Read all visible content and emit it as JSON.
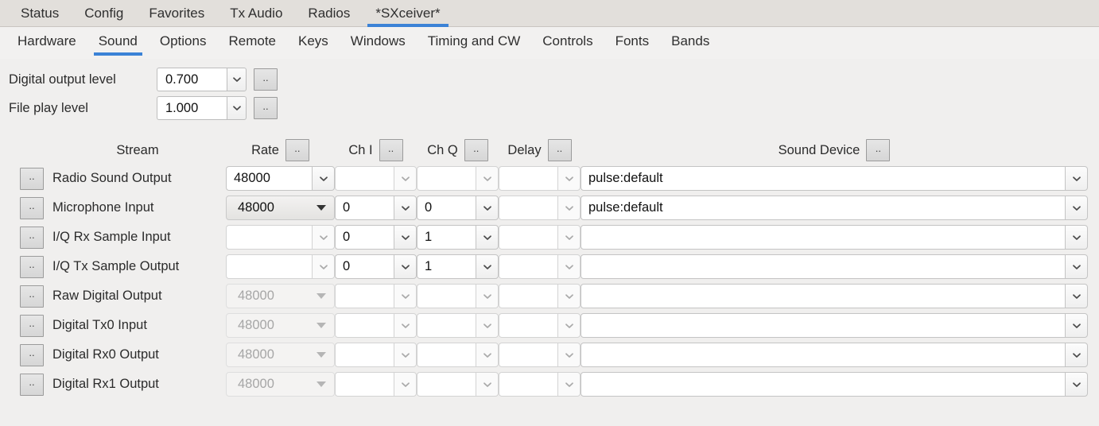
{
  "accent_color": "#3b82d6",
  "top_tabs": [
    {
      "label": "Status",
      "active": false
    },
    {
      "label": "Config",
      "active": false
    },
    {
      "label": "Favorites",
      "active": false
    },
    {
      "label": "Tx Audio",
      "active": false
    },
    {
      "label": "Radios",
      "active": false
    },
    {
      "label": "*SXceiver*",
      "active": true
    }
  ],
  "sub_tabs": [
    {
      "label": "Hardware",
      "active": false
    },
    {
      "label": "Sound",
      "active": true
    },
    {
      "label": "Options",
      "active": false
    },
    {
      "label": "Remote",
      "active": false
    },
    {
      "label": "Keys",
      "active": false
    },
    {
      "label": "Windows",
      "active": false
    },
    {
      "label": "Timing and CW",
      "active": false
    },
    {
      "label": "Controls",
      "active": false
    },
    {
      "label": "Fonts",
      "active": false
    },
    {
      "label": "Bands",
      "active": false
    }
  ],
  "levels": [
    {
      "label": "Digital output level",
      "value": "0.700",
      "button": ".."
    },
    {
      "label": "File play level",
      "value": "1.000",
      "button": ".."
    }
  ],
  "headers": {
    "stream": "Stream",
    "rate": "Rate",
    "rate_btn": "..",
    "ch_i": "Ch I",
    "ch_i_btn": "..",
    "ch_q": "Ch Q",
    "ch_q_btn": "..",
    "delay": "Delay",
    "delay_btn": "..",
    "device": "Sound Device",
    "device_btn": ".."
  },
  "rows": [
    {
      "button": "..",
      "stream": "Radio Sound Output",
      "rate": "48000",
      "rate_style": "editable",
      "rate_enabled": true,
      "ch_i": "",
      "ch_q": "",
      "delay": "",
      "device": "pulse:default"
    },
    {
      "button": "..",
      "stream": "Microphone Input",
      "rate": "48000",
      "rate_style": "dropdown",
      "rate_enabled": true,
      "ch_i": "0",
      "ch_q": "0",
      "delay": "",
      "device": "pulse:default"
    },
    {
      "button": "..",
      "stream": "I/Q Rx Sample Input",
      "rate": "",
      "rate_style": "editable",
      "rate_enabled": true,
      "ch_i": "0",
      "ch_q": "1",
      "delay": "",
      "device": ""
    },
    {
      "button": "..",
      "stream": "I/Q Tx Sample Output",
      "rate": "",
      "rate_style": "editable",
      "rate_enabled": true,
      "ch_i": "0",
      "ch_q": "1",
      "delay": "",
      "device": ""
    },
    {
      "button": "..",
      "stream": "Raw Digital Output",
      "rate": "48000",
      "rate_style": "dropdown",
      "rate_enabled": false,
      "ch_i": "",
      "ch_q": "",
      "delay": "",
      "device": ""
    },
    {
      "button": "..",
      "stream": "Digital Tx0 Input",
      "rate": "48000",
      "rate_style": "dropdown",
      "rate_enabled": false,
      "ch_i": "",
      "ch_q": "",
      "delay": "",
      "device": ""
    },
    {
      "button": "..",
      "stream": "Digital Rx0 Output",
      "rate": "48000",
      "rate_style": "dropdown",
      "rate_enabled": false,
      "ch_i": "",
      "ch_q": "",
      "delay": "",
      "device": ""
    },
    {
      "button": "..",
      "stream": "Digital Rx1 Output",
      "rate": "48000",
      "rate_style": "dropdown",
      "rate_enabled": false,
      "ch_i": "",
      "ch_q": "",
      "delay": "",
      "device": ""
    }
  ]
}
